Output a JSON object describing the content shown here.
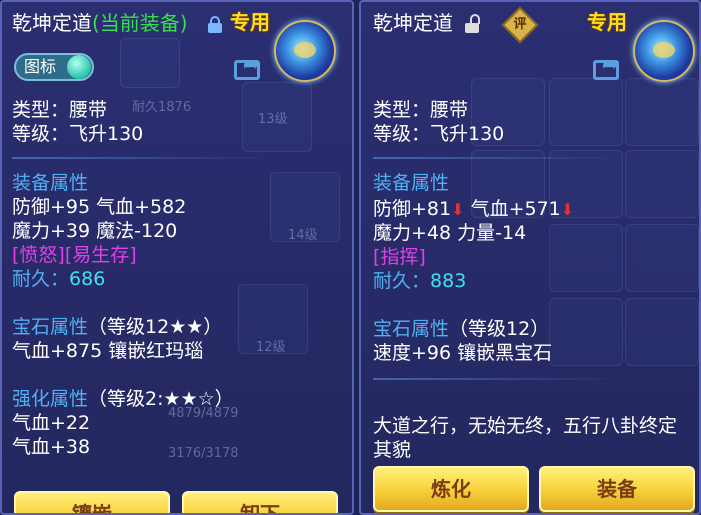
{
  "left": {
    "title": "乾坤定道",
    "current_tag": "(当前装备)",
    "special": "专用",
    "toggle_label": "图标",
    "type_line": "类型：腰带",
    "level_line": "等级：飞升130",
    "equip_attr_header": "装备属性",
    "stat1": "防御+95 气血+582",
    "stat2": "魔力+39 魔法-120",
    "special_effect": "[愤怒][易生存]",
    "durability_label": "耐久：",
    "durability_value": "686",
    "gem_header": "宝石属性",
    "gem_level": "（等级12★★）",
    "gem_line": "气血+875 镶嵌红玛瑙",
    "enhance_header": "强化属性",
    "enhance_level": "（等级2:★★☆）",
    "enhance1": "气血+22",
    "enhance2": "气血+38",
    "btn_inlay": "镶嵌",
    "btn_remove": "卸下"
  },
  "right": {
    "title": "乾坤定道",
    "rating_badge": "评",
    "special": "专用",
    "type_line": "类型：腰带",
    "level_line": "等级：飞升130",
    "equip_attr_header": "装备属性",
    "stat_def": "防御+81",
    "stat_hp": "气血+571",
    "down_arrow": "⬇",
    "stat2": "魔力+48 力量-14",
    "special_effect": "[指挥]",
    "durability_label": "耐久：",
    "durability_value": "883",
    "gem_header": "宝石属性",
    "gem_level": "（等级12）",
    "gem_line": "速度+96 镶嵌黑宝石",
    "description_line1": "大道之行，无始无终，五行八卦终定",
    "description_line2": "其貌",
    "btn_refine": "炼化",
    "btn_equip": "装备"
  },
  "background_hints": {
    "level13": "13级",
    "level14": "14级",
    "level12": "12级",
    "hp_bar1": "4879/4879",
    "hp_bar2": "3176/3178",
    "durability_ghost": "耐久1876"
  },
  "colors": {
    "panel_bg": "#2b2f72",
    "section_blue": "#4fb0f2",
    "green": "#35e04a",
    "cyan_value": "#40e0f0",
    "purple_effect": "#e040e8",
    "special_gold": "#ffdd22",
    "button_gold": "#f8cf3a"
  }
}
